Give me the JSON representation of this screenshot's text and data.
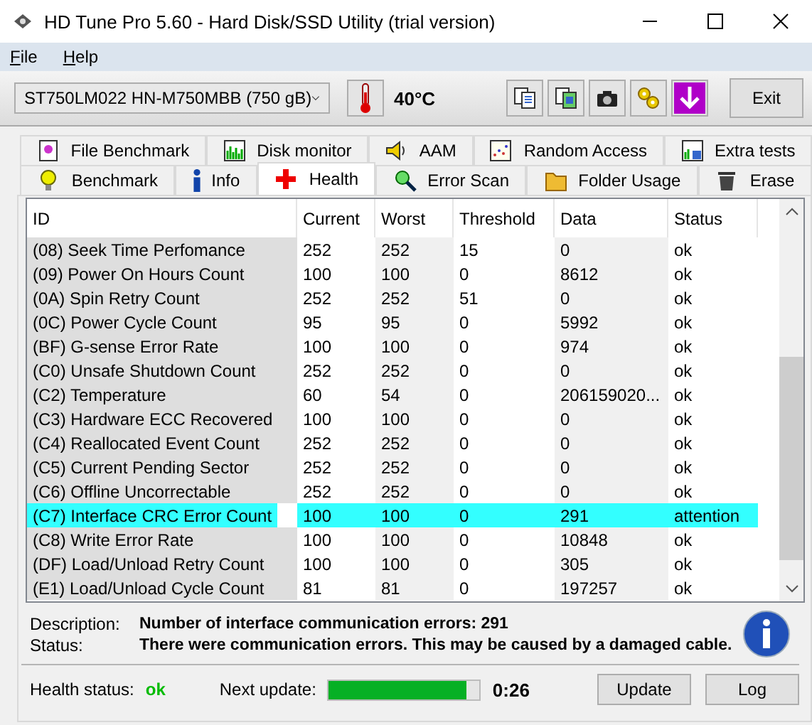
{
  "window": {
    "title": "HD Tune Pro 5.60 - Hard Disk/SSD Utility (trial version)"
  },
  "menu": [
    "File",
    "Help"
  ],
  "toolbar": {
    "drive": "ST750LM022 HN-M750MBB (750 gB)",
    "temperature": "40°C",
    "exit": "Exit"
  },
  "tab_rows": [
    [
      {
        "label": "File Benchmark",
        "selected": false
      },
      {
        "label": "Disk monitor",
        "selected": false
      },
      {
        "label": "AAM",
        "selected": false
      },
      {
        "label": "Random Access",
        "selected": false
      },
      {
        "label": "Extra tests",
        "selected": false
      }
    ],
    [
      {
        "label": "Benchmark",
        "selected": false
      },
      {
        "label": "Info",
        "selected": false
      },
      {
        "label": "Health",
        "selected": true
      },
      {
        "label": "Error Scan",
        "selected": false
      },
      {
        "label": "Folder Usage",
        "selected": false
      },
      {
        "label": "Erase",
        "selected": false
      }
    ]
  ],
  "table": {
    "columns": [
      "ID",
      "Current",
      "Worst",
      "Threshold",
      "Data",
      "Status"
    ],
    "rows": [
      {
        "cells": [
          "(08) Seek Time Perfomance",
          "252",
          "252",
          "15",
          "0",
          "ok"
        ],
        "selected": false
      },
      {
        "cells": [
          "(09) Power On Hours Count",
          "100",
          "100",
          "0",
          "8612",
          "ok"
        ],
        "selected": false
      },
      {
        "cells": [
          "(0A) Spin Retry Count",
          "252",
          "252",
          "51",
          "0",
          "ok"
        ],
        "selected": false
      },
      {
        "cells": [
          "(0C) Power Cycle Count",
          "95",
          "95",
          "0",
          "5992",
          "ok"
        ],
        "selected": false
      },
      {
        "cells": [
          "(BF) G-sense Error Rate",
          "100",
          "100",
          "0",
          "974",
          "ok"
        ],
        "selected": false
      },
      {
        "cells": [
          "(C0) Unsafe Shutdown Count",
          "252",
          "252",
          "0",
          "0",
          "ok"
        ],
        "selected": false
      },
      {
        "cells": [
          "(C2) Temperature",
          "60",
          "54",
          "0",
          "206159020...",
          "ok"
        ],
        "selected": false
      },
      {
        "cells": [
          "(C3) Hardware ECC Recovered",
          "100",
          "100",
          "0",
          "0",
          "ok"
        ],
        "selected": false
      },
      {
        "cells": [
          "(C4) Reallocated Event Count",
          "252",
          "252",
          "0",
          "0",
          "ok"
        ],
        "selected": false
      },
      {
        "cells": [
          "(C5) Current Pending Sector",
          "252",
          "252",
          "0",
          "0",
          "ok"
        ],
        "selected": false
      },
      {
        "cells": [
          "(C6) Offline Uncorrectable",
          "252",
          "252",
          "0",
          "0",
          "ok"
        ],
        "selected": false
      },
      {
        "cells": [
          "(C7) Interface CRC Error Count",
          "100",
          "100",
          "0",
          "291",
          "attention"
        ],
        "selected": true
      },
      {
        "cells": [
          "(C8) Write Error Rate",
          "100",
          "100",
          "0",
          "10848",
          "ok"
        ],
        "selected": false
      },
      {
        "cells": [
          "(DF) Load/Unload Retry Count",
          "100",
          "100",
          "0",
          "305",
          "ok"
        ],
        "selected": false
      },
      {
        "cells": [
          "(E1) Load/Unload Cycle Count",
          "81",
          "81",
          "0",
          "197257",
          "ok"
        ],
        "selected": false
      }
    ]
  },
  "details": {
    "description_label": "Description:",
    "description": "Number of interface communication errors: 291",
    "status_label": "Status:",
    "status": "There were communication errors. This may be caused by a damaged cable."
  },
  "footer": {
    "health_label": "Health status:",
    "health": "ok",
    "next_update_label": "Next update:",
    "level": 0.91,
    "time": "0:26",
    "buttons": [
      "Update",
      "Log"
    ]
  }
}
